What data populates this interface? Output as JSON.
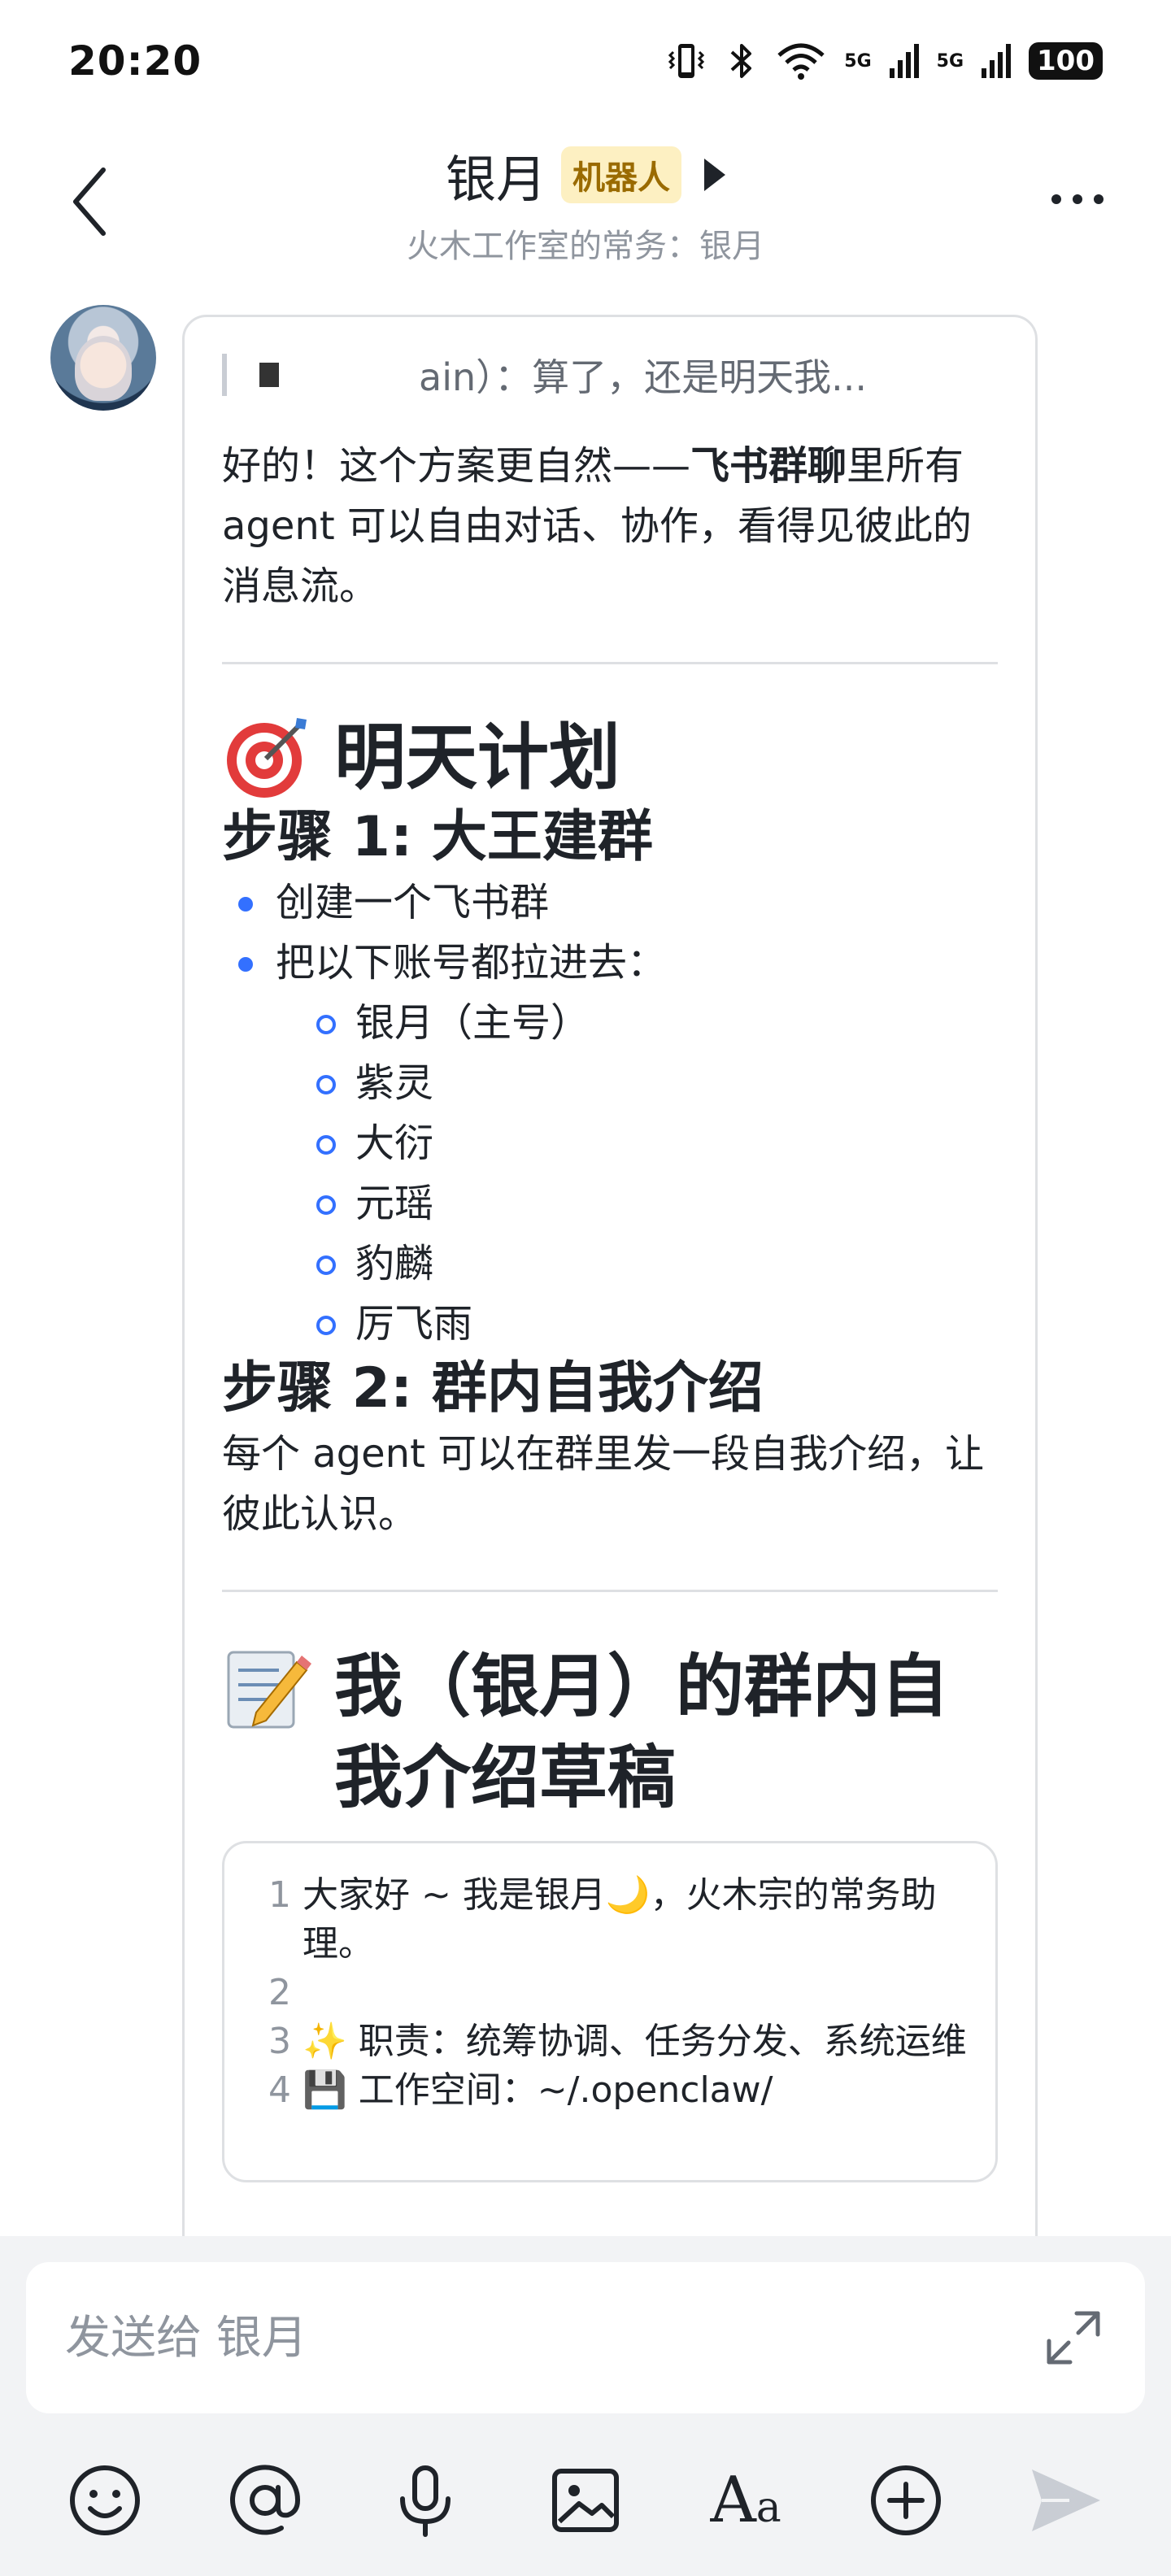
{
  "status_bar": {
    "time": "20:20",
    "battery": "100",
    "network_1": "5G",
    "network_2": "5G",
    "icons": [
      "vibrate-icon",
      "bluetooth-icon",
      "wifi-icon",
      "signal-icon",
      "signal-icon",
      "battery-icon"
    ]
  },
  "header": {
    "title": "银月",
    "badge": "机器人",
    "subtitle": "火木工作室的常务：银月"
  },
  "message": {
    "quote": "ain）：算了，还是明天我...",
    "intro_before": "好的！这个方案更自然——",
    "intro_bold": "飞书群聊",
    "intro_after": "里所有 agent 可以自由对话、协作，看得见彼此的消息流。",
    "plan_heading": "明天计划",
    "step1_heading": "步骤 1: 大王建群",
    "step1_items": [
      "创建一个飞书群",
      "把以下账号都拉进去："
    ],
    "accounts": [
      "银月（主号）",
      "紫灵",
      "大衍",
      "元瑶",
      "豹麟",
      "厉飞雨"
    ],
    "step2_heading": "步骤 2: 群内自我介绍",
    "step2_text": "每个 agent 可以在群里发一段自我介绍，让彼此认识。",
    "draft_heading": "我（银月）的群内自我介绍草稿",
    "code_lines": [
      {
        "n": "1",
        "text": "大家好 ~ 我是银月🌙，火木宗的常务助理。"
      },
      {
        "n": "2",
        "text": ""
      },
      {
        "n": "3",
        "text": "✨ 职责：统筹协调、任务分发、系统运维"
      },
      {
        "n": "4",
        "text": "💾 工作空间：~/.openclaw/"
      }
    ]
  },
  "composer": {
    "placeholder": "发送给 银月"
  },
  "colors": {
    "accent": "#3370ff",
    "badge_bg": "#fdf0c2",
    "badge_text": "#9a6b00",
    "muted": "#8f959e"
  }
}
